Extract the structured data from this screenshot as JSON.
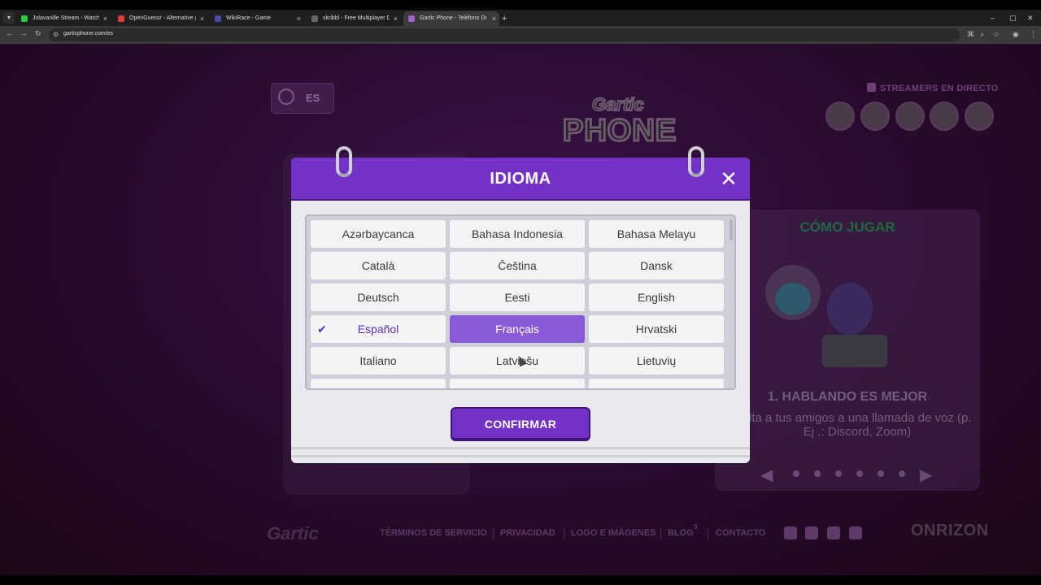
{
  "browser": {
    "tabs": [
      {
        "title": "Jolavanille Stream - Watch Live",
        "favicon_color": "#2ecc40",
        "active": false
      },
      {
        "title": "OpenGuessr - Alternative gratis",
        "favicon_color": "#e03a3a",
        "active": false
      },
      {
        "title": "WikiRace - Game",
        "favicon_color": "#4a4aaa",
        "active": false
      },
      {
        "title": "skribbl - Free Multiplayer Draw",
        "favicon_color": "#666666",
        "active": false
      },
      {
        "title": "Gartic Phone - Teléfono Desco",
        "favicon_color": "#a060d0",
        "active": true
      }
    ],
    "url": "garticphone.com/es",
    "new_tab_icon": "+",
    "window_controls": [
      "–",
      "▢",
      "✕"
    ]
  },
  "background": {
    "language_code": "ES",
    "logo_line1": "Gartic",
    "logo_line2": "PHONE",
    "streamers_title": "STREAMERS EN DIRECTO",
    "how_to": {
      "title": "CÓMO JUGAR",
      "step_title": "1. HABLANDO ES MEJOR",
      "step_text": "vita a tus amigos a una llamada de voz (p. Ej .: Discord, Zoom)"
    },
    "footer": {
      "logo": "Gartic",
      "links": [
        "TÉRMINOS DE SERVICIO",
        "PRIVACIDAD",
        "LOGO E IMÁGENES",
        "BLOG",
        "CONTACTO"
      ],
      "blog_badge": "3",
      "company": "ONRIZON"
    }
  },
  "modal": {
    "title": "IDIOMA",
    "close_icon": "✕",
    "confirm_label": "CONFIRMAR",
    "languages": [
      [
        "Azərbaycanca",
        "Bahasa Indonesia",
        "Bahasa Melayu"
      ],
      [
        "Català",
        "Čeština",
        "Dansk"
      ],
      [
        "Deutsch",
        "Eesti",
        "English"
      ],
      [
        "Español",
        "Français",
        "Hrvatski"
      ],
      [
        "Italiano",
        "Latviešu",
        "Lietuvių"
      ]
    ],
    "selected": "Español",
    "hovered": "Français",
    "check_icon": "✔"
  },
  "colors": {
    "accent": "#7331c6",
    "selected_text": "#5a2dbd",
    "hover_bg": "#8a5bd9"
  }
}
